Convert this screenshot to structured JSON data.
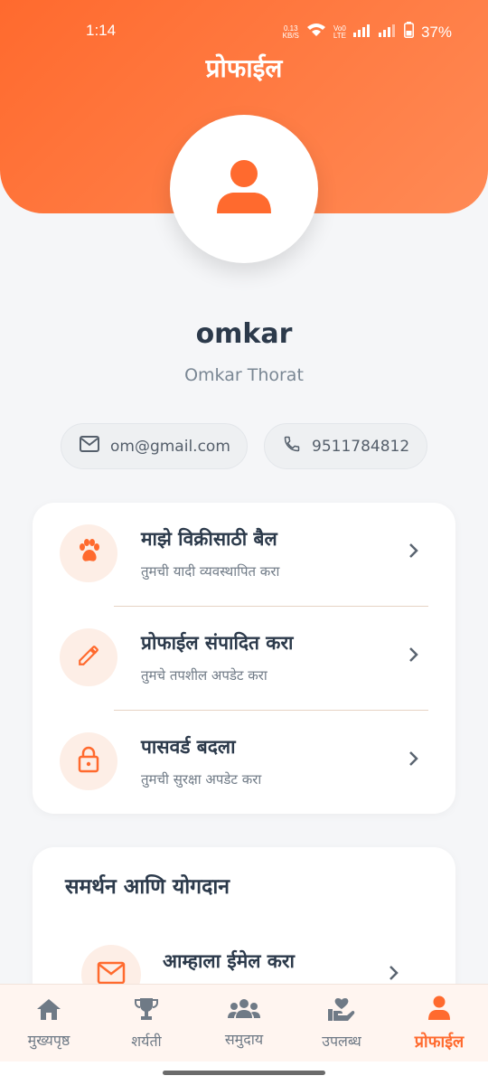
{
  "status_bar": {
    "time": "1:14",
    "net_speed_top": "0.13",
    "net_speed_bottom": "KB/S",
    "volte_top": "Vo0",
    "volte_bottom": "LTE",
    "battery": "37%"
  },
  "header": {
    "title": "प्रोफाईल"
  },
  "profile": {
    "username": "omkar",
    "full_name": "Omkar Thorat",
    "email": "om@gmail.com",
    "phone": "9511784812"
  },
  "menu": [
    {
      "title": "माझे विक्रीसाठी बैल",
      "subtitle": "तुमची यादी व्यवस्थापित करा",
      "icon": "paw-icon"
    },
    {
      "title": "प्रोफाईल संपादित करा",
      "subtitle": "तुमचे तपशील अपडेट करा",
      "icon": "pencil-icon"
    },
    {
      "title": "पासवर्ड बदला",
      "subtitle": "तुमची सुरक्षा अपडेट करा",
      "icon": "lock-icon"
    }
  ],
  "support": {
    "title": "समर्थन आणि योगदान",
    "items": [
      {
        "title": "आम्हाला ईमेल करा",
        "icon": "mail-icon"
      }
    ]
  },
  "bottom_nav": [
    {
      "label": "मुख्यपृष्ठ",
      "icon": "home-icon",
      "active": false
    },
    {
      "label": "शर्यती",
      "icon": "trophy-icon",
      "active": false
    },
    {
      "label": "समुदाय",
      "icon": "group-icon",
      "active": false
    },
    {
      "label": "उपलब्ध",
      "icon": "hand-heart-icon",
      "active": false
    },
    {
      "label": "प्रोफाईल",
      "icon": "person-icon",
      "active": true
    }
  ],
  "colors": {
    "accent": "#ff6a2e",
    "accent_light": "#fdeee6",
    "text_dark": "#2c3a4b",
    "text_muted": "#6f7a86"
  }
}
